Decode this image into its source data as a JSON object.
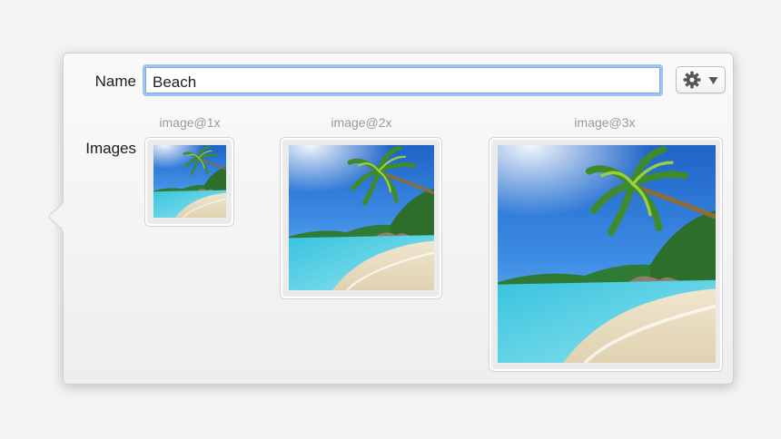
{
  "form": {
    "name_label": "Name",
    "name_value": "Beach",
    "images_label": "Images"
  },
  "gear_menu": {
    "icon": "gear-icon",
    "indicator": "chevron-down-icon"
  },
  "image_slots": [
    {
      "caption": "image@1x"
    },
    {
      "caption": "image@2x"
    },
    {
      "caption": "image@3x"
    }
  ],
  "colors": {
    "focus_ring": "#9fc3f0",
    "selection": "#b3d3f8",
    "caption": "#9a9a9a"
  }
}
